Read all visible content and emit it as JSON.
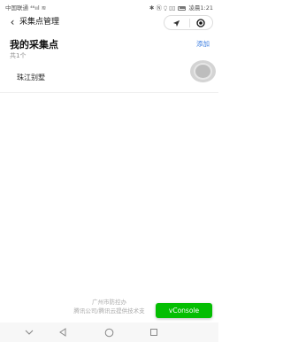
{
  "status_bar": {
    "carrier": "中国联通",
    "signal_text": "⁴⁶ııl ≋",
    "status_icons": "✱ Ⓝ ⍜ ▯▯",
    "battery_icon": "battery-icon",
    "time": "凌晨1:21"
  },
  "nav": {
    "back_icon": "chevron-left-icon",
    "back_glyph": "‹",
    "title": "采集点管理",
    "capsule": {
      "left_icon": "location-arrow-icon",
      "right_icon": "target-icon"
    }
  },
  "main": {
    "title": "我的采集点",
    "add_label": "添加",
    "count_label": "共1个",
    "items": [
      {
        "label": "珠江别墅"
      }
    ]
  },
  "footer": {
    "line1": "广州市防控办",
    "line2": "腾讯公司/腾讯云提供技术支"
  },
  "vconsole": {
    "label": "vConsole",
    "color": "#04be02"
  },
  "android_nav": {
    "icons": [
      "chevron-down-icon",
      "back-triangle-icon",
      "home-circle-icon",
      "recent-square-icon"
    ]
  },
  "colors": {
    "accent": "#3b7de0"
  }
}
